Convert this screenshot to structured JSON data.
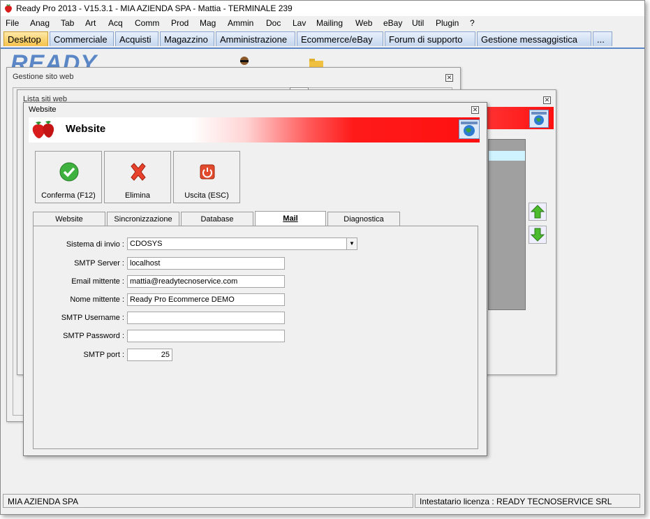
{
  "app": {
    "title": "Ready Pro 2013 - V15.3.1 - MIA AZIENDA SPA - Mattia - TERMINALE 239"
  },
  "menu": [
    "File",
    "Anag",
    "Tab",
    "Art",
    "Acq",
    "Comm",
    "Prod",
    "Mag",
    "Ammin",
    "Doc",
    "Lav",
    "Mailing",
    "Web",
    "eBay",
    "Util",
    "Plugin",
    "?"
  ],
  "tabs": [
    "Desktop",
    "Commerciale",
    "Acquisti",
    "Magazzino",
    "Amministrazione",
    "Ecommerce/eBay",
    "Forum di supporto",
    "Gestione messaggistica",
    "..."
  ],
  "background": {
    "logo_text": "READY",
    "win1_title": "Gestione sito web",
    "win2_title": "Lista siti web"
  },
  "dialog": {
    "title": "Website",
    "banner_title": "Website",
    "buttons": {
      "confirm": "Conferma (F12)",
      "delete": "Elimina",
      "exit": "Uscita (ESC)"
    },
    "subtabs": [
      "Website",
      "Sincronizzazione",
      "Database",
      "Mail",
      "Diagnostica"
    ],
    "active_subtab": "Mail",
    "form": {
      "sistema_label": "Sistema di invio :",
      "sistema_value": "CDOSYS",
      "smtp_server_label": "SMTP Server :",
      "smtp_server_value": "localhost",
      "email_label": "Email mittente :",
      "email_value": "mattia@readytecnoservice.com",
      "nome_label": "Nome mittente :",
      "nome_value": "Ready Pro Ecommerce DEMO",
      "username_label": "SMTP Username :",
      "username_value": "",
      "password_label": "SMTP Password :",
      "password_value": "",
      "port_label": "SMTP port :",
      "port_value": "25"
    }
  },
  "status": {
    "company": "MIA AZIENDA SPA",
    "license": "Intestatario licenza : READY TECNOSERVICE SRL"
  },
  "colors": {
    "accent_blue": "#5b87c6",
    "active_tab": "#f5c24a",
    "banner_red": "#ff1010"
  }
}
